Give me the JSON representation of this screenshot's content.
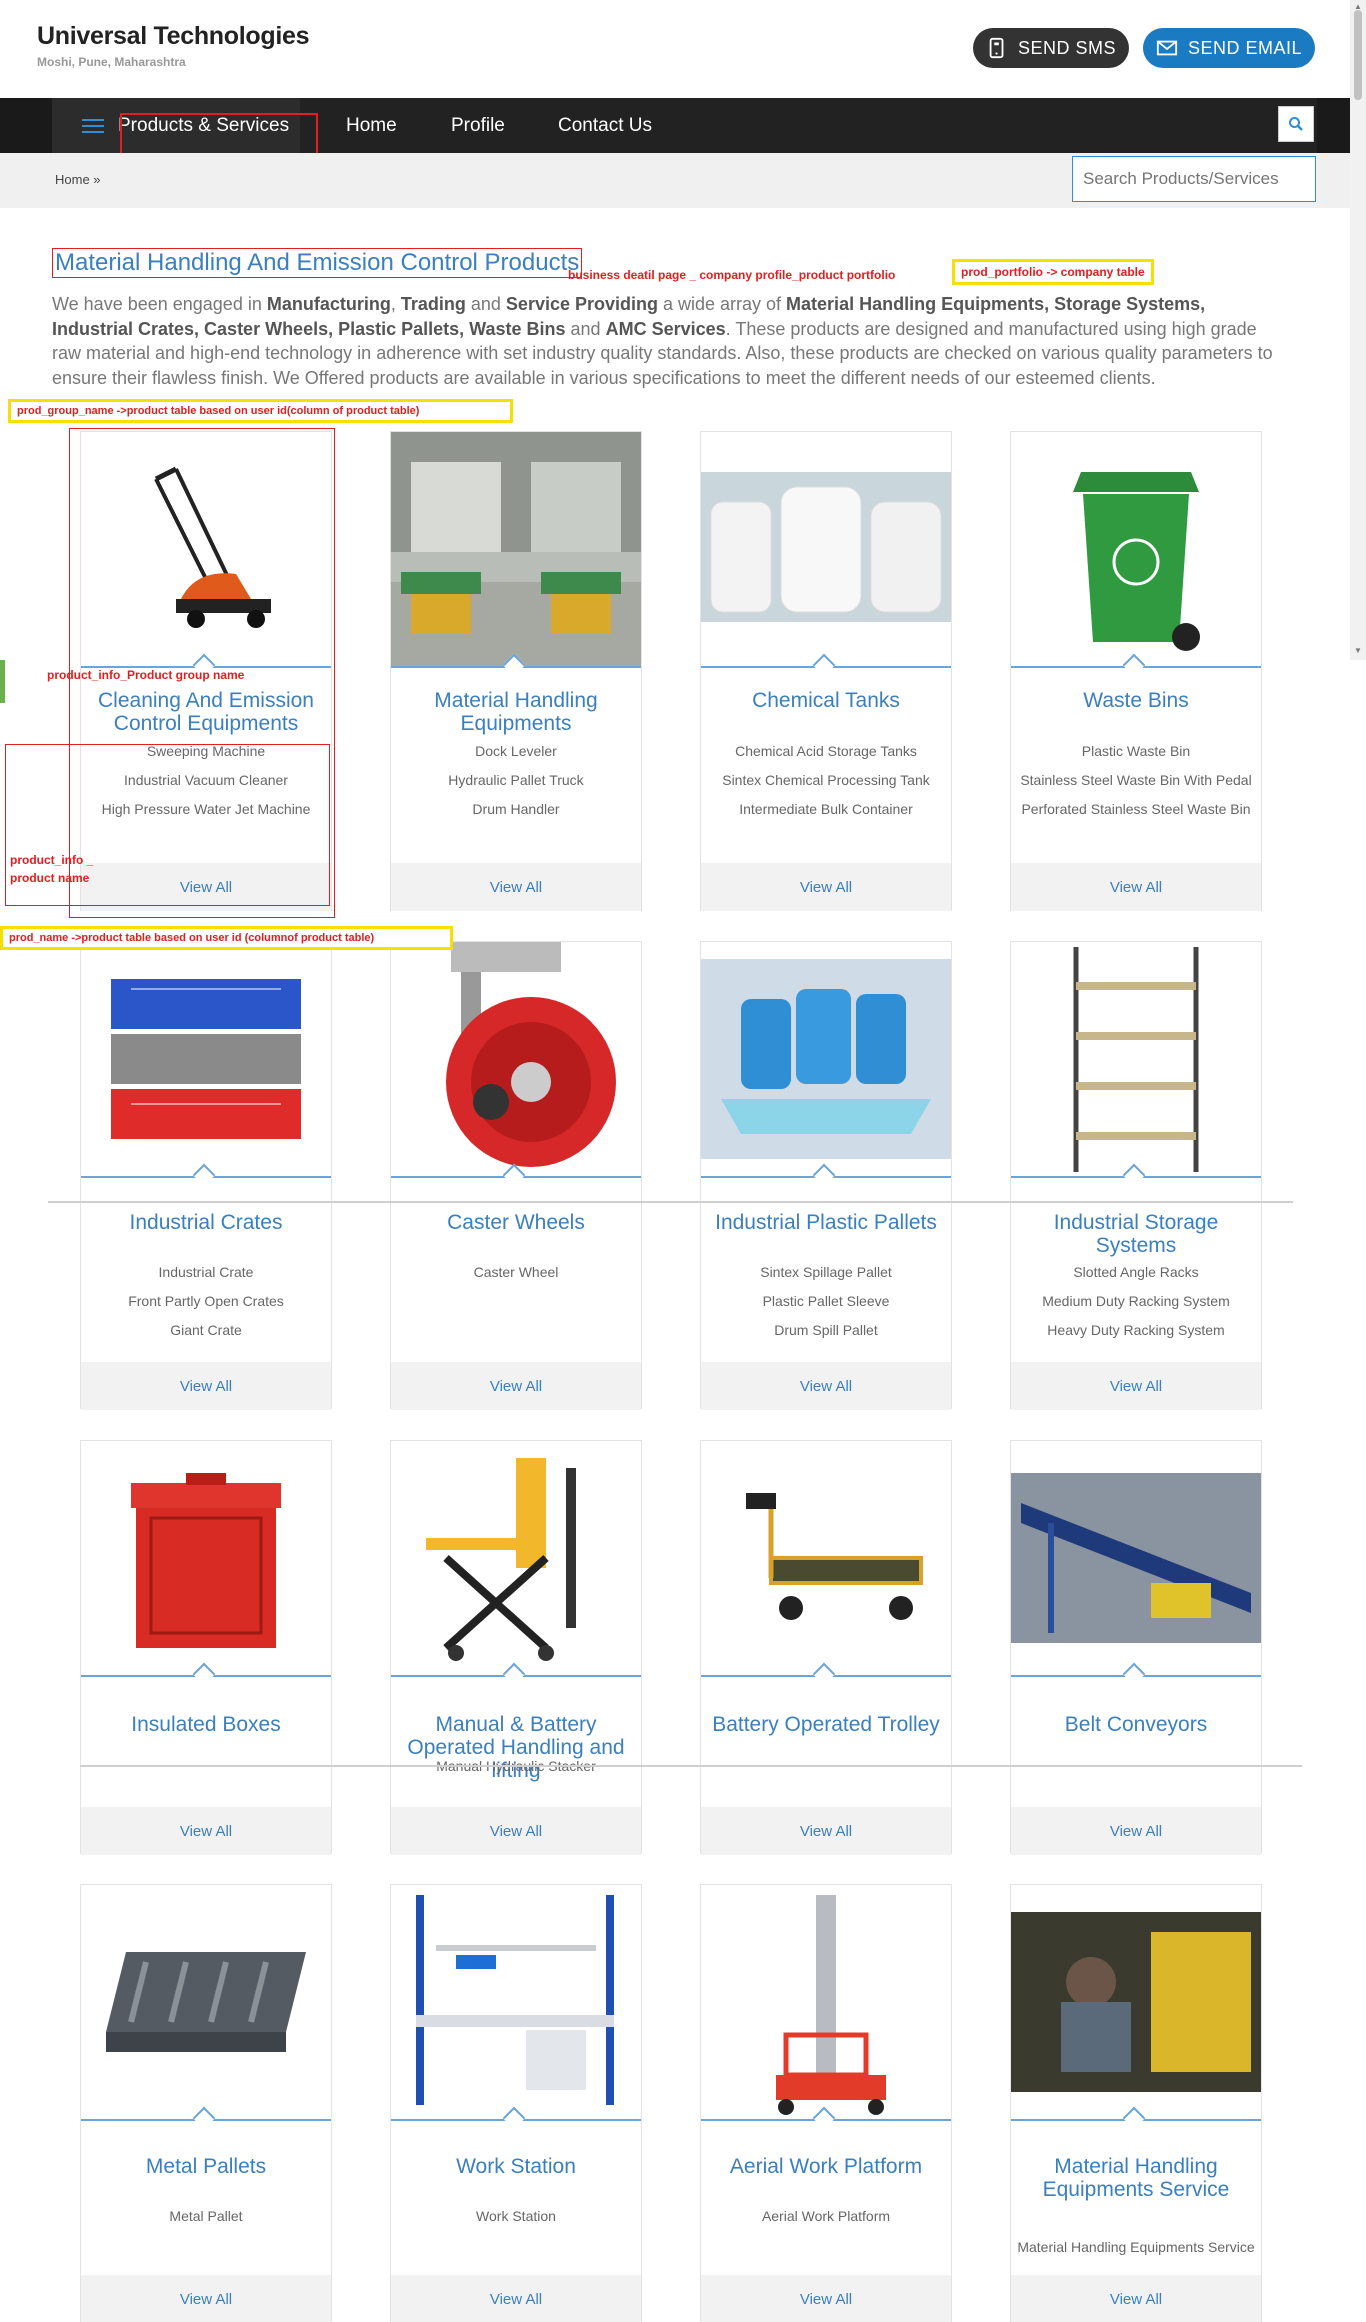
{
  "header": {
    "company": "Universal Technologies",
    "location": "Moshi, Pune, Maharashtra",
    "sms_label": "SEND SMS",
    "email_label": "SEND EMAIL"
  },
  "nav": {
    "menu_label": "Products & Services",
    "links": [
      "Home",
      "Profile",
      "Contact Us"
    ]
  },
  "breadcrumb": "Home »",
  "search": {
    "placeholder": "Search Products/Services"
  },
  "page": {
    "title": "Material Handling And Emission Control Products",
    "intro_parts": [
      "We have been engaged in ",
      "Manufacturing",
      ", ",
      "Trading",
      " and ",
      "Service Providing",
      " a wide array of ",
      "Material Handling Equipments, Storage Systems, Industrial Crates, Caster Wheels, Plastic Pallets, Waste Bins",
      " and ",
      "AMC Services",
      ". These products are designed and manufactured using high grade raw material and high-end technology in adherence with set industry quality standards. Also, these products are checked on various quality parameters to ensure their flawless finish. We Offered products are available in various specifications to meet the different needs of our esteemed clients."
    ]
  },
  "annotations": {
    "business_detail": "business deatil page _ company profile_product portfolio",
    "prod_portfolio": "prod_portfolio -> company table",
    "prod_group_name": "prod_group_name ->product table based on user id(column of product table)",
    "product_info_group": "product_info_Product group name",
    "product_info_name_1": "product_info _",
    "product_info_name_2": "product name",
    "prod_name": "prod_name ->product table based on user id (columnof product table)"
  },
  "view_all_label": "View All",
  "products": [
    {
      "title": "Cleaning And Emission Control Equipments",
      "items": [
        "Sweeping Machine",
        "Industrial Vacuum Cleaner",
        "High Pressure Water Jet Machine"
      ],
      "icon": "sweeper-image"
    },
    {
      "title": "Material Handling Equipments",
      "items": [
        "Dock Leveler",
        "Hydraulic Pallet Truck",
        "Drum Handler"
      ],
      "icon": "dock-leveler-image"
    },
    {
      "title": "Chemical Tanks",
      "items": [
        "Chemical Acid Storage Tanks",
        "Sintex Chemical Processing Tank",
        "Intermediate Bulk Container"
      ],
      "icon": "tanks-image"
    },
    {
      "title": "Waste Bins",
      "items": [
        "Plastic Waste Bin",
        "Stainless Steel Waste Bin With Pedal",
        "Perforated Stainless Steel Waste Bin"
      ],
      "icon": "waste-bin-image"
    },
    {
      "title": "Industrial Crates",
      "items": [
        "Industrial Crate",
        "Front Partly Open Crates",
        "Giant Crate"
      ],
      "icon": "crates-image"
    },
    {
      "title": "Caster Wheels",
      "items": [
        "Caster Wheel"
      ],
      "icon": "caster-wheel-image"
    },
    {
      "title": "Industrial Plastic Pallets",
      "items": [
        "Sintex Spillage Pallet",
        "Plastic Pallet Sleeve",
        "Drum Spill Pallet"
      ],
      "icon": "pallet-drums-image"
    },
    {
      "title": "Industrial Storage Systems",
      "items": [
        "Slotted Angle Racks",
        "Medium Duty Racking System",
        "Heavy Duty Racking System"
      ],
      "icon": "rack-image"
    },
    {
      "title": "Insulated Boxes",
      "items": [],
      "icon": "insulated-box-image"
    },
    {
      "title": "Manual & Battery Operated Handling and lifting",
      "items": [
        "Manual Hydraulic Stacker"
      ],
      "icon": "scissor-lift-image"
    },
    {
      "title": "Battery Operated Trolley",
      "items": [],
      "icon": "trolley-image"
    },
    {
      "title": "Belt Conveyors",
      "items": [],
      "icon": "conveyor-image"
    },
    {
      "title": "Metal Pallets",
      "items": [
        "Metal Pallet"
      ],
      "icon": "metal-pallet-image"
    },
    {
      "title": "Work Station",
      "items": [
        "Work Station"
      ],
      "icon": "workstation-image"
    },
    {
      "title": "Aerial Work Platform",
      "items": [
        "Aerial Work Platform"
      ],
      "icon": "aerial-platform-image"
    },
    {
      "title": "Material Handling Equipments Service",
      "items": [
        "Material Handling Equipments Service"
      ],
      "icon": "service-image"
    }
  ],
  "colors": {
    "accent": "#3a7fbf",
    "email_button": "#1a7bc2",
    "sms_button": "#333333",
    "nav_bg": "#1a1a1a",
    "annotation_red": "#e02020",
    "annotation_yellow": "#f5e000"
  }
}
